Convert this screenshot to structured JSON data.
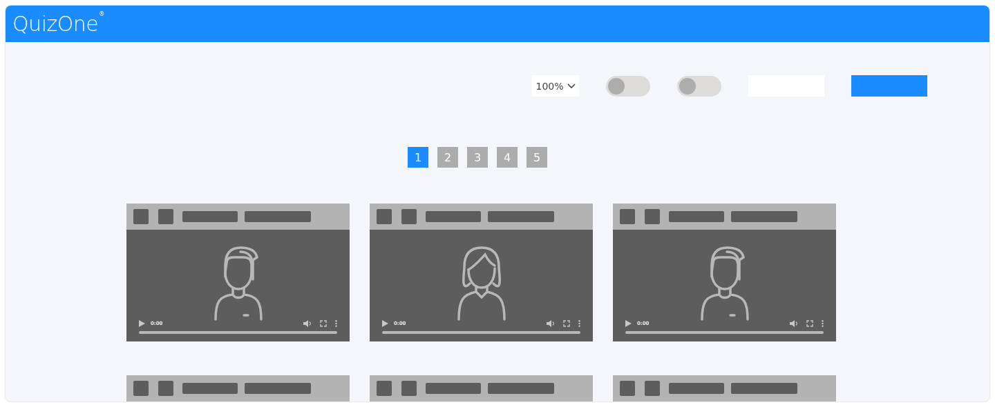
{
  "header": {
    "logo": "QuizOne",
    "mark": "®"
  },
  "toolbar": {
    "zoom": "100%",
    "toggles": [
      {
        "on": false
      },
      {
        "on": false
      }
    ]
  },
  "pagination": [
    {
      "label": "1",
      "selected": true
    },
    {
      "label": "2",
      "selected": false
    },
    {
      "label": "3",
      "selected": false
    },
    {
      "label": "4",
      "selected": false
    },
    {
      "label": "5",
      "selected": false
    }
  ],
  "videos": [
    {
      "kind": "man",
      "time": "0:00"
    },
    {
      "kind": "woman",
      "time": "0:00"
    },
    {
      "kind": "man",
      "time": "0:00"
    },
    {
      "kind": "cut"
    },
    {
      "kind": "cut"
    },
    {
      "kind": "cut"
    }
  ]
}
